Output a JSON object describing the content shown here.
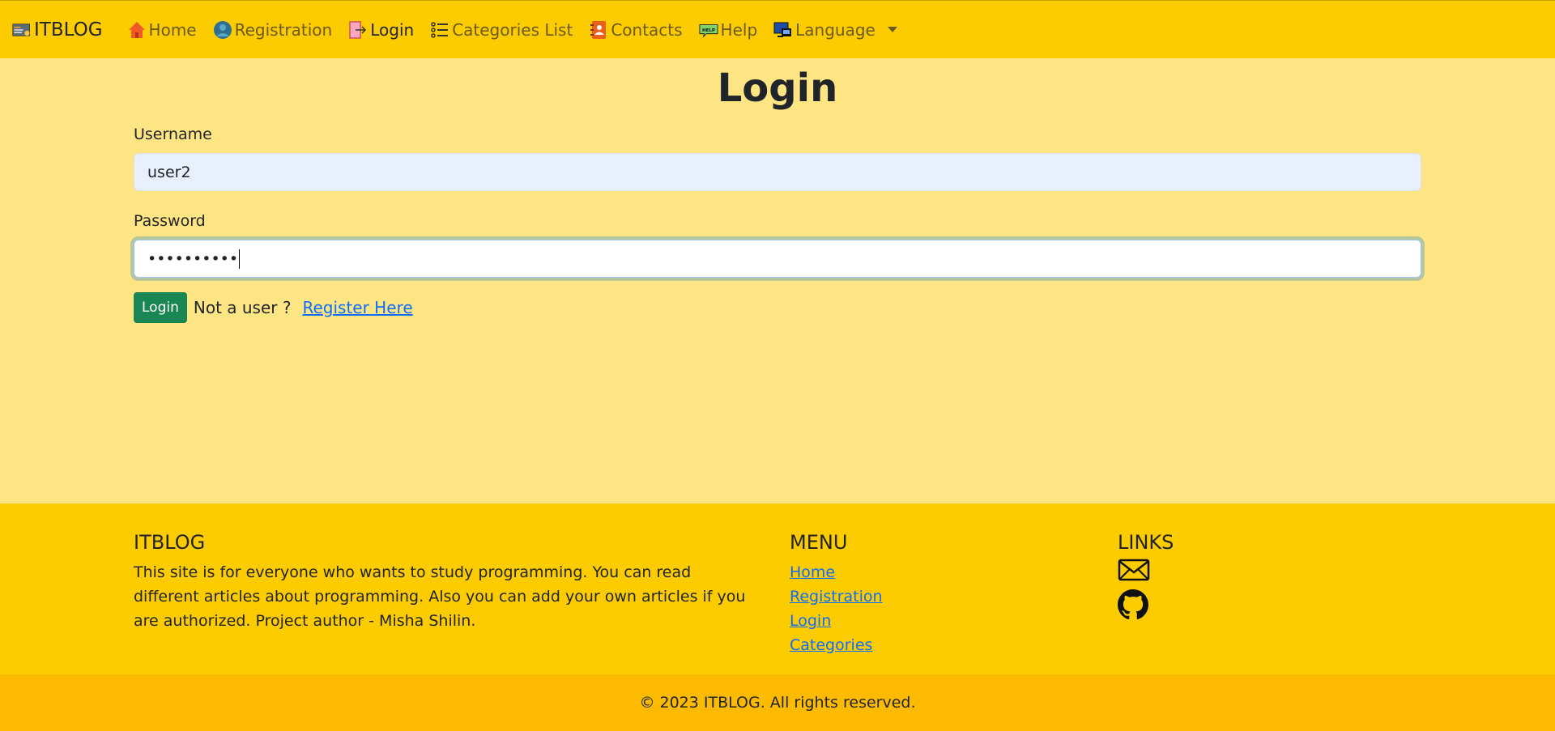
{
  "nav": {
    "brand": "ITBLOG",
    "items": [
      {
        "label": "Home"
      },
      {
        "label": "Registration"
      },
      {
        "label": "Login"
      },
      {
        "label": "Categories List"
      },
      {
        "label": "Contacts"
      },
      {
        "label": "Help"
      },
      {
        "label": "Language"
      }
    ]
  },
  "main": {
    "title": "Login",
    "username_label": "Username",
    "username_value": "user2",
    "password_label": "Password",
    "password_value": "••••••••••",
    "login_button": "Login",
    "not_user_text": "Not a user ?",
    "register_link": "Register Here"
  },
  "footer": {
    "about_title": "ITBLOG",
    "about_text": "This site is for everyone who wants to study programming. You can read different articles about programming. Also you can add your own articles if you are authorized. Project author - Misha Shilin.",
    "menu_title": "MENU",
    "menu_items": [
      "Home",
      "Registration",
      "Login",
      "Categories"
    ],
    "links_title": "LINKS",
    "link_icons": [
      "envelope-icon",
      "github-icon"
    ]
  },
  "copyright": "© 2023 ITBLOG. All rights reserved.",
  "colors": {
    "navbar": "#fccb00",
    "background": "#fde583",
    "footer_bottom": "#fcbb00",
    "button": "#198754",
    "link": "#0d6efd"
  }
}
